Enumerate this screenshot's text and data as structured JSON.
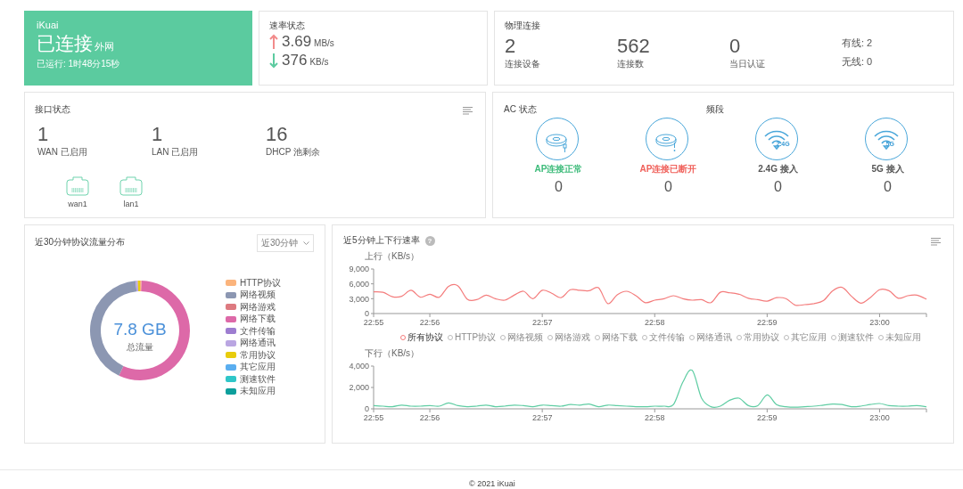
{
  "status_card": {
    "brand": "iKuai",
    "status": "已连接",
    "network": "外网",
    "uptime": "已运行: 1时48分15秒"
  },
  "speed": {
    "title": "速率状态",
    "rows": [
      {
        "kind": "up",
        "color": "#f28b8b",
        "value": "3.69",
        "unit": "MB/s"
      },
      {
        "kind": "down",
        "color": "#5ccba0",
        "value": "376",
        "unit": "KB/s"
      }
    ]
  },
  "physical": {
    "title": "物理连接",
    "stats": [
      {
        "value": "2",
        "label": "连接设备"
      },
      {
        "value": "562",
        "label": "连接数"
      },
      {
        "value": "0",
        "label": "当日认证"
      }
    ],
    "breakdown": [
      "有线: 2",
      "无线: 0"
    ]
  },
  "interfaces": {
    "title": "接口状态",
    "stats": [
      {
        "value": "1",
        "label": "WAN 已启用"
      },
      {
        "value": "1",
        "label": "LAN 已启用"
      },
      {
        "value": "16",
        "label": "DHCP 池剩余"
      }
    ],
    "ports": [
      {
        "label": "wan1"
      },
      {
        "label": "lan1"
      }
    ]
  },
  "ac": {
    "title": "AC 状态",
    "band_title": "频段",
    "items": [
      {
        "kind": "ap-ok",
        "label": "AP连接正常",
        "color": "#3dbb7a",
        "count": "0"
      },
      {
        "kind": "ap-down",
        "label": "AP连接已断开",
        "color": "#f0605a",
        "count": "0"
      },
      {
        "kind": "wifi",
        "badge": "2.4G",
        "label": "2.4G 接入",
        "color": "#555555",
        "count": "0"
      },
      {
        "kind": "wifi",
        "badge": "5G",
        "label": "5G 接入",
        "color": "#555555",
        "count": "0"
      }
    ]
  },
  "protocol_traffic": {
    "title": "近30分钟协议流量分布",
    "period": "近30分钟",
    "total": "7.8 GB",
    "total_label": "总流量",
    "legend": [
      {
        "label": "HTTP协议",
        "color": "#fbb47c"
      },
      {
        "label": "网络视频",
        "color": "#8c97b2"
      },
      {
        "label": "网络游戏",
        "color": "#dd7a80"
      },
      {
        "label": "网络下载",
        "color": "#dd69a8"
      },
      {
        "label": "文件传输",
        "color": "#9d7dd0"
      },
      {
        "label": "网络通讯",
        "color": "#baa6e2"
      },
      {
        "label": "常用协议",
        "color": "#e8cc0c"
      },
      {
        "label": "其它应用",
        "color": "#5aaef0"
      },
      {
        "label": "测速软件",
        "color": "#2fc6c8"
      },
      {
        "label": "未知应用",
        "color": "#0d9f9c"
      }
    ]
  },
  "rate": {
    "title": "近5分钟上下行速率",
    "help": "?",
    "upload": {
      "chart_data": {
        "type": "line",
        "ylabel": "上行（KB/s）",
        "categories": [
          "22:55",
          null,
          null,
          null,
          null,
          null,
          "22:56",
          null,
          null,
          null,
          null,
          null,
          null,
          null,
          null,
          null,
          null,
          null,
          "22:57",
          null,
          null,
          null,
          null,
          null,
          null,
          null,
          null,
          null,
          null,
          null,
          "22:58",
          null,
          null,
          null,
          null,
          null,
          null,
          null,
          null,
          null,
          null,
          null,
          "22:59",
          null,
          null,
          null,
          null,
          null,
          null,
          null,
          null,
          null,
          null,
          null,
          "23:00",
          null,
          null,
          null,
          null,
          null
        ],
        "series": [
          {
            "color": "#f47c7c",
            "values": [
              4400,
              4300,
              3400,
              3500,
              4700,
              3300,
              3900,
              3300,
              5500,
              5600,
              2900,
              2800,
              3700,
              3000,
              2700,
              3700,
              4500,
              3000,
              4700,
              4100,
              3200,
              4800,
              4700,
              4600,
              5200,
              2000,
              3800,
              4500,
              3600,
              2200,
              2700,
              3000,
              3600,
              3000,
              2700,
              2800,
              2200,
              4300,
              4200,
              3900,
              3100,
              2800,
              2500,
              3200,
              3000,
              1700,
              1800,
              2000,
              2600,
              4600,
              5300,
              3500,
              2100,
              3200,
              4800,
              4600,
              3100,
              3600,
              3700,
              2900
            ]
          }
        ],
        "ylim": [
          0,
          9000
        ],
        "yticks": [
          {
            "value": 0,
            "label": "0"
          },
          {
            "value": 3000,
            "label": "3,000"
          },
          {
            "value": 6000,
            "label": "6,000"
          },
          {
            "value": 9000,
            "label": "9,000"
          }
        ]
      }
    },
    "filters": [
      {
        "label": "所有协议",
        "selected": true
      },
      {
        "label": "HTTP协议",
        "selected": false
      },
      {
        "label": "网络视频",
        "selected": false
      },
      {
        "label": "网络游戏",
        "selected": false
      },
      {
        "label": "网络下载",
        "selected": false
      },
      {
        "label": "文件传输",
        "selected": false
      },
      {
        "label": "网络通讯",
        "selected": false
      },
      {
        "label": "常用协议",
        "selected": false
      },
      {
        "label": "其它应用",
        "selected": false
      },
      {
        "label": "测速软件",
        "selected": false
      },
      {
        "label": "未知应用",
        "selected": false
      }
    ],
    "download": {
      "chart_data": {
        "type": "line",
        "ylabel": "下行（KB/s）",
        "categories": [
          "22:55",
          null,
          null,
          null,
          null,
          null,
          "22:56",
          null,
          null,
          null,
          null,
          null,
          null,
          null,
          null,
          null,
          null,
          null,
          "22:57",
          null,
          null,
          null,
          null,
          null,
          null,
          null,
          null,
          null,
          null,
          null,
          "22:58",
          null,
          null,
          null,
          null,
          null,
          null,
          null,
          null,
          null,
          null,
          null,
          "22:59",
          null,
          null,
          null,
          null,
          null,
          null,
          null,
          null,
          null,
          null,
          null,
          "23:00",
          null,
          null,
          null,
          null,
          null
        ],
        "series": [
          {
            "color": "#5fcda3",
            "values": [
              300,
              250,
              200,
              350,
              250,
              250,
              300,
              250,
              550,
              300,
              200,
              250,
              350,
              200,
              250,
              350,
              300,
              200,
              350,
              300,
              250,
              400,
              350,
              450,
              200,
              350,
              300,
              250,
              200,
              200,
              250,
              250,
              400,
              2500,
              3600,
              1000,
              200,
              250,
              800,
              1000,
              300,
              300,
              1300,
              400,
              200,
              150,
              200,
              250,
              350,
              450,
              400,
              200,
              250,
              400,
              500,
              300,
              250,
              250,
              300,
              200
            ]
          }
        ],
        "ylim": [
          0,
          4000
        ],
        "yticks": [
          {
            "value": 0,
            "label": "0"
          },
          {
            "value": 2000,
            "label": "2,000"
          },
          {
            "value": 4000,
            "label": "4,000"
          }
        ]
      }
    }
  },
  "footer": "© 2021 iKuai"
}
